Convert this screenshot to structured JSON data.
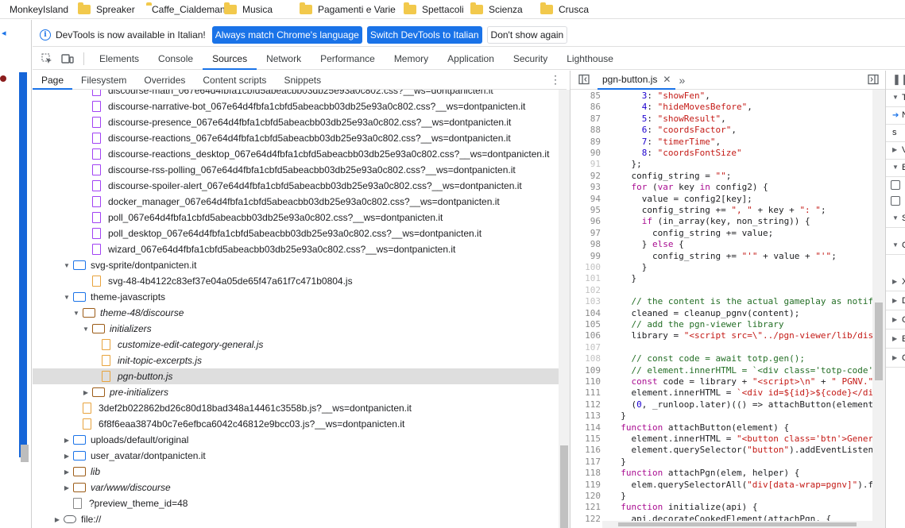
{
  "bookmarks": [
    {
      "label": "MonkeyIsland",
      "folder": false
    },
    {
      "label": "Spreaker",
      "folder": true
    },
    {
      "label": "Caffe_Cialdemania",
      "folder": true
    },
    {
      "label": "Musica",
      "folder": true
    },
    {
      "label": "Pagamenti e Varie",
      "folder": true
    },
    {
      "label": "Spettacoli",
      "folder": true
    },
    {
      "label": "Scienza",
      "folder": true
    },
    {
      "label": "Crusca",
      "folder": true
    }
  ],
  "infobar": {
    "text": "DevTools is now available in Italian!",
    "btn_match": "Always match Chrome's language",
    "btn_switch": "Switch DevTools to Italian",
    "btn_dismiss": "Don't show again"
  },
  "tabs": [
    "Elements",
    "Console",
    "Sources",
    "Network",
    "Performance",
    "Memory",
    "Application",
    "Security",
    "Lighthouse"
  ],
  "active_tab": "Sources",
  "subtabs": [
    "Page",
    "Filesystem",
    "Overrides",
    "Content scripts",
    "Snippets"
  ],
  "tree": [
    {
      "label": "discourse-math_067e64d4fbfa1cbfd5abeacbb03db25e93a0c802.css?__ws=dontpanicten.it",
      "type": "css",
      "indent": 0,
      "arrow": ""
    },
    {
      "label": "discourse-narrative-bot_067e64d4fbfa1cbfd5abeacbb03db25e93a0c802.css?__ws=dontpanicten.it",
      "type": "css",
      "indent": 0,
      "arrow": ""
    },
    {
      "label": "discourse-presence_067e64d4fbfa1cbfd5abeacbb03db25e93a0c802.css?__ws=dontpanicten.it",
      "type": "css",
      "indent": 0,
      "arrow": ""
    },
    {
      "label": "discourse-reactions_067e64d4fbfa1cbfd5abeacbb03db25e93a0c802.css?__ws=dontpanicten.it",
      "type": "css",
      "indent": 0,
      "arrow": ""
    },
    {
      "label": "discourse-reactions_desktop_067e64d4fbfa1cbfd5abeacbb03db25e93a0c802.css?__ws=dontpanicten.it",
      "type": "css",
      "indent": 0,
      "arrow": ""
    },
    {
      "label": "discourse-rss-polling_067e64d4fbfa1cbfd5abeacbb03db25e93a0c802.css?__ws=dontpanicten.it",
      "type": "css",
      "indent": 0,
      "arrow": ""
    },
    {
      "label": "discourse-spoiler-alert_067e64d4fbfa1cbfd5abeacbb03db25e93a0c802.css?__ws=dontpanicten.it",
      "type": "css",
      "indent": 0,
      "arrow": ""
    },
    {
      "label": "docker_manager_067e64d4fbfa1cbfd5abeacbb03db25e93a0c802.css?__ws=dontpanicten.it",
      "type": "css",
      "indent": 0,
      "arrow": ""
    },
    {
      "label": "poll_067e64d4fbfa1cbfd5abeacbb03db25e93a0c802.css?__ws=dontpanicten.it",
      "type": "css",
      "indent": 0,
      "arrow": ""
    },
    {
      "label": "poll_desktop_067e64d4fbfa1cbfd5abeacbb03db25e93a0c802.css?__ws=dontpanicten.it",
      "type": "css",
      "indent": 0,
      "arrow": ""
    },
    {
      "label": "wizard_067e64d4fbfa1cbfd5abeacbb03db25e93a0c802.css?__ws=dontpanicten.it",
      "type": "css",
      "indent": 0,
      "arrow": ""
    },
    {
      "label": "svg-sprite/dontpanicten.it",
      "type": "folder",
      "indent": -2,
      "arrow": "open"
    },
    {
      "label": "svg-48-4b4122c83ef37e04a05de65f47a61f7c471b0804.js",
      "type": "js",
      "indent": 0,
      "arrow": ""
    },
    {
      "label": "theme-javascripts",
      "type": "folder",
      "indent": -2,
      "arrow": "open"
    },
    {
      "label": "theme-48/discourse",
      "type": "folder-brown",
      "indent": -1,
      "arrow": "open",
      "italic": true
    },
    {
      "label": "initializers",
      "type": "folder-brown",
      "indent": 0,
      "arrow": "open",
      "italic": true
    },
    {
      "label": "customize-edit-category-general.js",
      "type": "js",
      "indent": 1,
      "arrow": "",
      "italic": true
    },
    {
      "label": "init-topic-excerpts.js",
      "type": "js",
      "indent": 1,
      "arrow": "",
      "italic": true
    },
    {
      "label": "pgn-button.js",
      "type": "js",
      "indent": 1,
      "arrow": "",
      "italic": true,
      "selected": true
    },
    {
      "label": "pre-initializers",
      "type": "folder-brown",
      "indent": 0,
      "arrow": "closed",
      "italic": true
    },
    {
      "label": "3def2b022862bd26c80d18bad348a14461c3558b.js?__ws=dontpanicten.it",
      "type": "js",
      "indent": -1,
      "arrow": ""
    },
    {
      "label": "6f8f6eaa3874b0c7e6efbca6042c46812e9bcc03.js?__ws=dontpanicten.it",
      "type": "js",
      "indent": -1,
      "arrow": ""
    },
    {
      "label": "uploads/default/original",
      "type": "folder",
      "indent": -2,
      "arrow": "closed"
    },
    {
      "label": "user_avatar/dontpanicten.it",
      "type": "folder",
      "indent": -2,
      "arrow": "closed"
    },
    {
      "label": "lib",
      "type": "folder-brown",
      "indent": -2,
      "arrow": "closed",
      "italic": true
    },
    {
      "label": "var/www/discourse",
      "type": "folder-brown",
      "indent": -2,
      "arrow": "closed",
      "italic": true
    },
    {
      "label": "?preview_theme_id=48",
      "type": "doc",
      "indent": -2,
      "arrow": ""
    },
    {
      "label": "file://",
      "type": "cloud",
      "indent": -3,
      "arrow": "closed"
    }
  ],
  "editor": {
    "tab_label": "pgn-button.js",
    "lines": [
      {
        "n": "85",
        "dim": false,
        "t": [
          [
            "pl",
            "      "
          ],
          [
            "num",
            "3"
          ],
          [
            "pl",
            ": "
          ],
          [
            "str",
            "\"showFen\""
          ],
          [
            "pl",
            ","
          ]
        ]
      },
      {
        "n": "86",
        "dim": false,
        "t": [
          [
            "pl",
            "      "
          ],
          [
            "num",
            "4"
          ],
          [
            "pl",
            ": "
          ],
          [
            "str",
            "\"hideMovesBefore\""
          ],
          [
            "pl",
            ","
          ]
        ]
      },
      {
        "n": "87",
        "dim": false,
        "t": [
          [
            "pl",
            "      "
          ],
          [
            "num",
            "5"
          ],
          [
            "pl",
            ": "
          ],
          [
            "str",
            "\"showResult\""
          ],
          [
            "pl",
            ","
          ]
        ]
      },
      {
        "n": "88",
        "dim": false,
        "t": [
          [
            "pl",
            "      "
          ],
          [
            "num",
            "6"
          ],
          [
            "pl",
            ": "
          ],
          [
            "str",
            "\"coordsFactor\""
          ],
          [
            "pl",
            ","
          ]
        ]
      },
      {
        "n": "89",
        "dim": false,
        "t": [
          [
            "pl",
            "      "
          ],
          [
            "num",
            "7"
          ],
          [
            "pl",
            ": "
          ],
          [
            "str",
            "\"timerTime\""
          ],
          [
            "pl",
            ","
          ]
        ]
      },
      {
        "n": "90",
        "dim": false,
        "t": [
          [
            "pl",
            "      "
          ],
          [
            "num",
            "8"
          ],
          [
            "pl",
            ": "
          ],
          [
            "str",
            "\"coordsFontSize\""
          ]
        ]
      },
      {
        "n": "91",
        "dim": true,
        "t": [
          [
            "pl",
            "    };"
          ]
        ]
      },
      {
        "n": "92",
        "dim": false,
        "t": [
          [
            "pl",
            "    config_string = "
          ],
          [
            "str",
            "\"\""
          ],
          [
            "pl",
            ";"
          ]
        ]
      },
      {
        "n": "93",
        "dim": false,
        "t": [
          [
            "pl",
            "    "
          ],
          [
            "kw",
            "for"
          ],
          [
            "pl",
            " ("
          ],
          [
            "kw",
            "var"
          ],
          [
            "pl",
            " key "
          ],
          [
            "kw",
            "in"
          ],
          [
            "pl",
            " config2) {"
          ]
        ]
      },
      {
        "n": "94",
        "dim": false,
        "t": [
          [
            "pl",
            "      value = config2[key];"
          ]
        ]
      },
      {
        "n": "95",
        "dim": false,
        "t": [
          [
            "pl",
            "      config_string += "
          ],
          [
            "str",
            "\", \""
          ],
          [
            "pl",
            " + key + "
          ],
          [
            "str",
            "\": \""
          ],
          [
            "pl",
            ";"
          ]
        ]
      },
      {
        "n": "96",
        "dim": false,
        "t": [
          [
            "pl",
            "      "
          ],
          [
            "kw",
            "if"
          ],
          [
            "pl",
            " (in_array(key, non_string)) {"
          ]
        ]
      },
      {
        "n": "97",
        "dim": false,
        "t": [
          [
            "pl",
            "        config_string += value;"
          ]
        ]
      },
      {
        "n": "98",
        "dim": false,
        "t": [
          [
            "pl",
            "      } "
          ],
          [
            "kw",
            "else"
          ],
          [
            "pl",
            " {"
          ]
        ]
      },
      {
        "n": "99",
        "dim": false,
        "t": [
          [
            "pl",
            "        config_string += "
          ],
          [
            "str",
            "\"'\""
          ],
          [
            "pl",
            " + value + "
          ],
          [
            "str",
            "\"'\""
          ],
          [
            "pl",
            ";"
          ]
        ]
      },
      {
        "n": "100",
        "dim": true,
        "t": [
          [
            "pl",
            "      }"
          ]
        ]
      },
      {
        "n": "101",
        "dim": true,
        "t": [
          [
            "pl",
            "    }"
          ]
        ]
      },
      {
        "n": "102",
        "dim": true,
        "t": [
          [
            "pl",
            ""
          ]
        ]
      },
      {
        "n": "103",
        "dim": true,
        "t": [
          [
            "com",
            "    // the content is the actual gameplay as notif"
          ]
        ]
      },
      {
        "n": "104",
        "dim": false,
        "t": [
          [
            "pl",
            "    cleaned = cleanup_pgnv(content);"
          ]
        ]
      },
      {
        "n": "105",
        "dim": false,
        "t": [
          [
            "com",
            "    // add the pgn-viewer library"
          ]
        ]
      },
      {
        "n": "106",
        "dim": false,
        "t": [
          [
            "pl",
            "    library = "
          ],
          [
            "str",
            "\"<script src=\\\"../pgn-viewer/lib/dis"
          ]
        ]
      },
      {
        "n": "107",
        "dim": true,
        "t": [
          [
            "pl",
            ""
          ]
        ]
      },
      {
        "n": "108",
        "dim": true,
        "t": [
          [
            "com",
            "    // const code = await totp.gen();"
          ]
        ]
      },
      {
        "n": "109",
        "dim": false,
        "t": [
          [
            "com",
            "    // element.innerHTML = `<div class='totp-code'"
          ]
        ]
      },
      {
        "n": "110",
        "dim": false,
        "t": [
          [
            "pl",
            "    "
          ],
          [
            "kw",
            "const"
          ],
          [
            "pl",
            " code = library + "
          ],
          [
            "str",
            "\"<script>\\n\""
          ],
          [
            "pl",
            " + "
          ],
          [
            "str",
            "\" PGNV.\""
          ]
        ]
      },
      {
        "n": "111",
        "dim": false,
        "t": [
          [
            "pl",
            "    element.innerHTML = "
          ],
          [
            "str",
            "`<div id=${id}>${code}</di"
          ]
        ]
      },
      {
        "n": "112",
        "dim": false,
        "t": [
          [
            "pl",
            "    ("
          ],
          [
            "num",
            "0"
          ],
          [
            "pl",
            ", _runloop.later)(() => attachButton(element"
          ]
        ]
      },
      {
        "n": "113",
        "dim": false,
        "t": [
          [
            "pl",
            "  }"
          ]
        ]
      },
      {
        "n": "114",
        "dim": false,
        "t": [
          [
            "pl",
            "  "
          ],
          [
            "kw",
            "function"
          ],
          [
            "pl",
            " attachButton(element) {"
          ]
        ]
      },
      {
        "n": "115",
        "dim": false,
        "t": [
          [
            "pl",
            "    element.innerHTML = "
          ],
          [
            "str",
            "\"<button class='btn'>Gener"
          ]
        ]
      },
      {
        "n": "116",
        "dim": false,
        "t": [
          [
            "pl",
            "    element.querySelector("
          ],
          [
            "str",
            "\"button\""
          ],
          [
            "pl",
            ").addEventListen"
          ]
        ]
      },
      {
        "n": "117",
        "dim": false,
        "t": [
          [
            "pl",
            "  }"
          ]
        ]
      },
      {
        "n": "118",
        "dim": false,
        "t": [
          [
            "pl",
            "  "
          ],
          [
            "kw",
            "function"
          ],
          [
            "pl",
            " attachPgn(elem, helper) {"
          ]
        ]
      },
      {
        "n": "119",
        "dim": false,
        "t": [
          [
            "pl",
            "    elem.querySelectorAll("
          ],
          [
            "str",
            "\"div[data-wrap=pgnv]\""
          ],
          [
            "pl",
            ").f"
          ]
        ]
      },
      {
        "n": "120",
        "dim": false,
        "t": [
          [
            "pl",
            "  }"
          ]
        ]
      },
      {
        "n": "121",
        "dim": false,
        "t": [
          [
            "pl",
            "  "
          ],
          [
            "kw",
            "function"
          ],
          [
            "pl",
            " initialize(api) {"
          ]
        ]
      },
      {
        "n": "122",
        "dim": false,
        "t": [
          [
            "pl",
            "    api.decorateCookedElement(attachPgn, {"
          ]
        ]
      }
    ]
  },
  "right_panel": {
    "rows": [
      {
        "label": "T",
        "tri": "down"
      },
      {
        "label": "N",
        "tri": "arrow"
      },
      {
        "label": "s",
        "tri": ""
      },
      {
        "label": "V",
        "tri": "right"
      },
      {
        "label": "B",
        "tri": "down"
      },
      {
        "label": "",
        "tri": "checkbox"
      },
      {
        "label": "",
        "tri": "checkbox"
      },
      {
        "label": "S",
        "tri": "down"
      },
      {
        "label": "C",
        "tri": "down"
      },
      {
        "label": "X",
        "tri": "right"
      },
      {
        "label": "D",
        "tri": "right"
      },
      {
        "label": "G",
        "tri": "right"
      },
      {
        "label": "E",
        "tri": "right"
      },
      {
        "label": "C",
        "tri": "right"
      }
    ]
  },
  "colors": {
    "accent": "#1a73e8",
    "selection": "#dedede",
    "js_icon": "#e8a33d",
    "css_icon": "#a142f4"
  }
}
